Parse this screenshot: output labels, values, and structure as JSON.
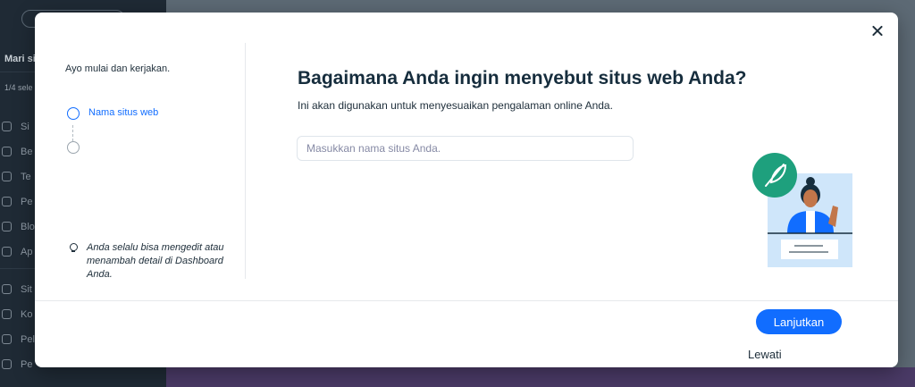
{
  "background": {
    "sidebar_title": "Mari si",
    "sidebar_progress": "1/4 sele",
    "sidebar_items": [
      {
        "label": "Si",
        "icon": "rocket-icon"
      },
      {
        "label": "Be",
        "icon": "home-icon"
      },
      {
        "label": "Te",
        "icon": "document-icon"
      },
      {
        "label": "Pe",
        "icon": "dollar-icon"
      },
      {
        "label": "Blo",
        "icon": "pen-icon"
      },
      {
        "label": "Ap",
        "icon": "apps-icon"
      },
      {
        "label": "Sit",
        "icon": "browser-icon"
      },
      {
        "label": "Ko",
        "icon": "inbox-icon"
      },
      {
        "label": "Pel",
        "icon": "users-icon"
      },
      {
        "label": "Pe",
        "icon": "megaphone-icon"
      }
    ]
  },
  "modal": {
    "intro": "Ayo mulai dan kerjakan.",
    "steps": [
      {
        "label": "Nama situs web",
        "active": true
      },
      {
        "label": "",
        "active": false
      }
    ],
    "tip": "Anda selalu bisa mengedit atau menambah detail di Dashboard Anda.",
    "title": "Bagaimana Anda ingin menyebut situs web Anda?",
    "subtitle": "Ini akan digunakan untuk menyesuaikan pengalaman online Anda.",
    "input": {
      "placeholder": "Masukkan nama situs Anda.",
      "value": ""
    },
    "skip_label": "Lewati",
    "next_label": "Lanjutkan",
    "illustration_icon": "feather-icon"
  },
  "colors": {
    "accent": "#116dff",
    "illustration_teal": "#1ea07d",
    "illustration_bg": "#cfe6fa"
  }
}
